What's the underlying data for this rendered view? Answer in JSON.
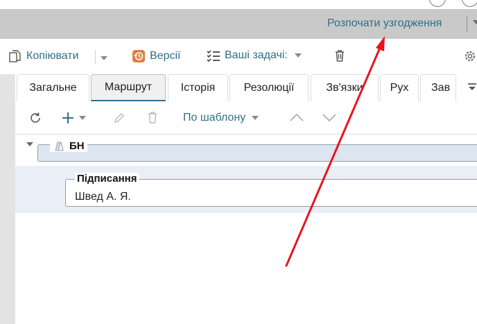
{
  "action_bar": {
    "start_approval_label": "Розпочати узгодження"
  },
  "toolbar": {
    "copy_label": "Копіювати",
    "versions_label": "Версії",
    "tasks_label": "Ваші задачі:"
  },
  "tabs": [
    {
      "label": "Загальне",
      "active": false
    },
    {
      "label": "Маршрут",
      "active": true
    },
    {
      "label": "Історія",
      "active": false
    },
    {
      "label": "Резолюції",
      "active": false
    },
    {
      "label": "Зв'язки",
      "active": false
    },
    {
      "label": "Рух",
      "active": false
    },
    {
      "label": "Зав",
      "active": false
    }
  ],
  "route_toolbar": {
    "template_label": "По шаблону"
  },
  "route": {
    "group_title": "БН",
    "stage": {
      "title": "Підписання",
      "person": "Швед А. Я."
    }
  },
  "colors": {
    "accent": "#2f6f87",
    "annotation_arrow": "#e8141b"
  }
}
